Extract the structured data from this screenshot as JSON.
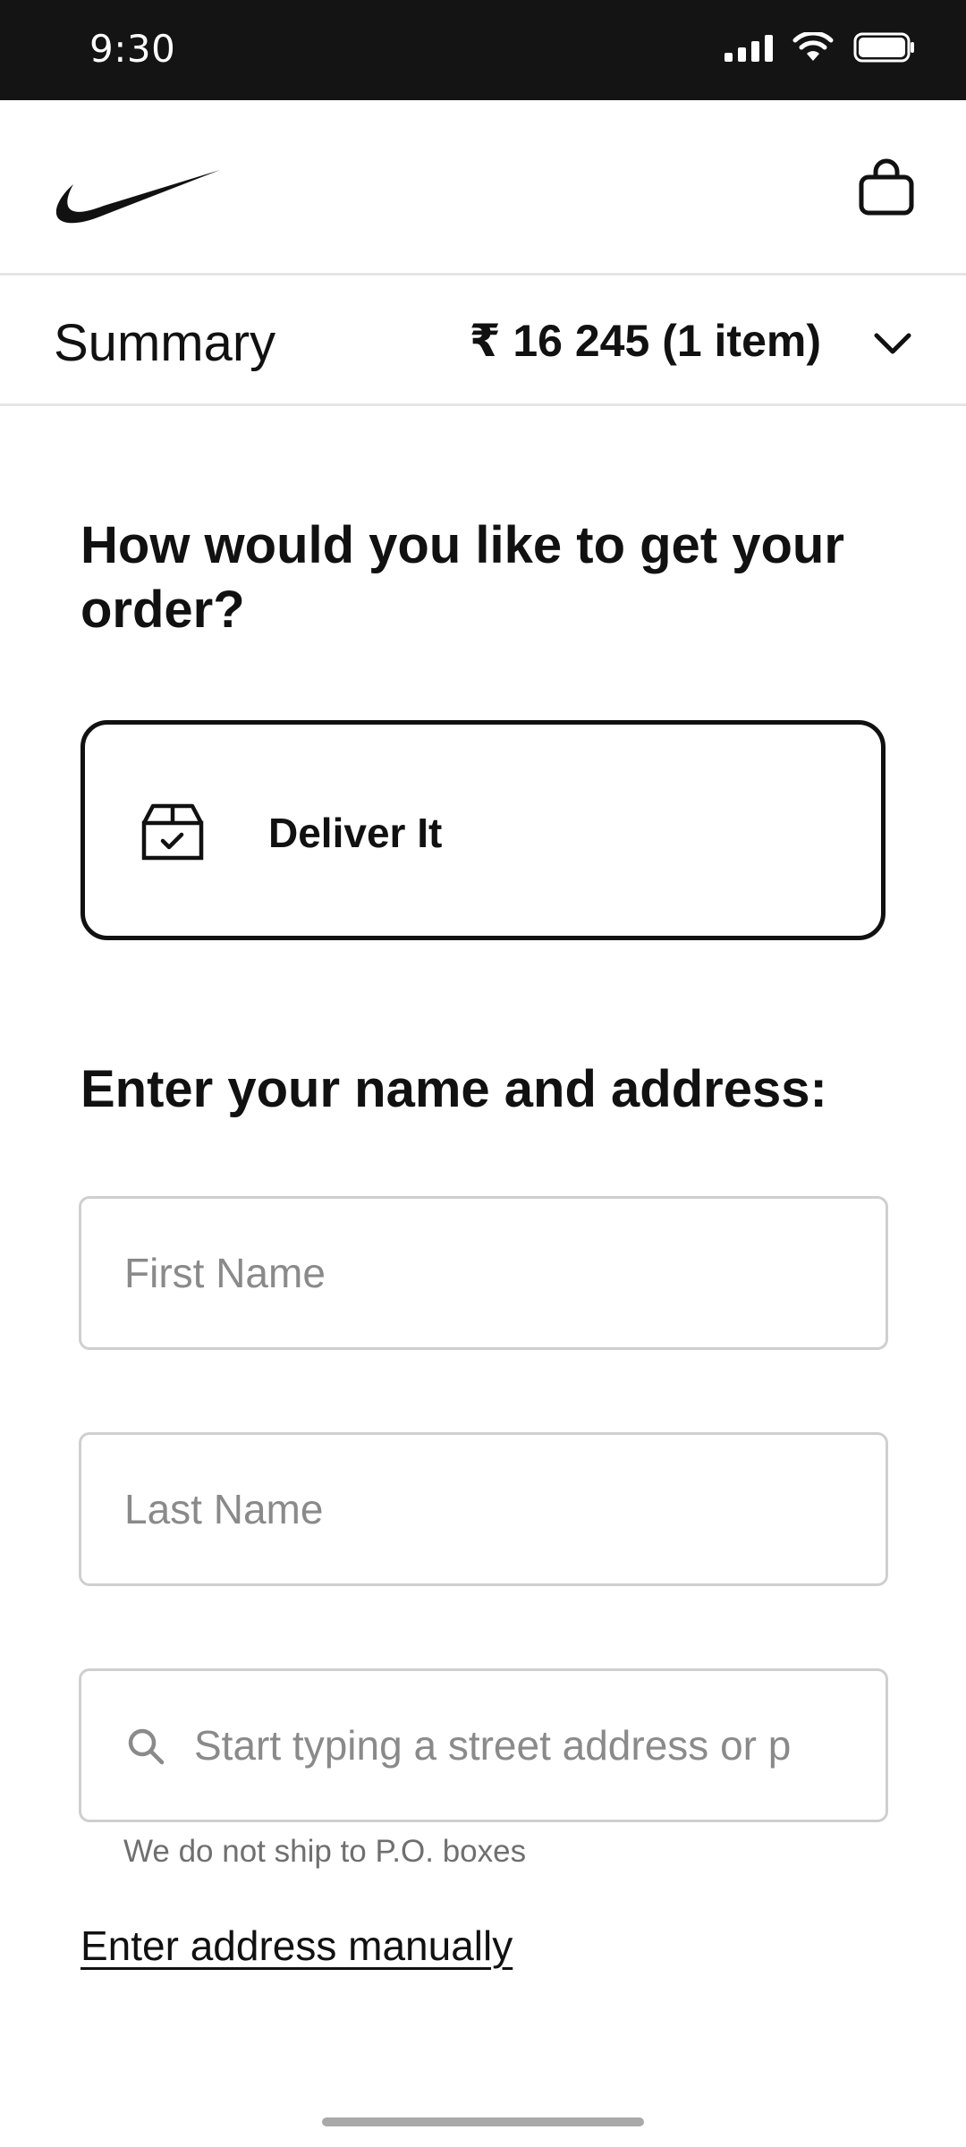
{
  "status_bar": {
    "time": "9:30",
    "icons": [
      "cellular-signal-icon",
      "wifi-icon",
      "battery-icon"
    ]
  },
  "header": {
    "logo": "nike-swoosh-logo",
    "bag_icon": "shopping-bag-icon"
  },
  "summary": {
    "title": "Summary",
    "total": "₹ 16 245 (1 item)",
    "toggle_icon": "chevron-down-icon"
  },
  "delivery": {
    "question": "How would you like to get your order?",
    "option_label": "Deliver It",
    "option_icon": "delivery-box-icon"
  },
  "address": {
    "heading": "Enter your name and address:",
    "first_name": {
      "value": "",
      "placeholder": "First Name"
    },
    "last_name": {
      "value": "",
      "placeholder": "Last Name"
    },
    "street": {
      "value": "",
      "placeholder": "Start typing a street address or p"
    },
    "helper": "We do not ship to P.O. boxes",
    "manual_link": "Enter address manually"
  },
  "colors": {
    "accent": "#111111",
    "border": "#cfcfcf",
    "status_bar": "#141414",
    "placeholder": "#8a8a8a"
  }
}
